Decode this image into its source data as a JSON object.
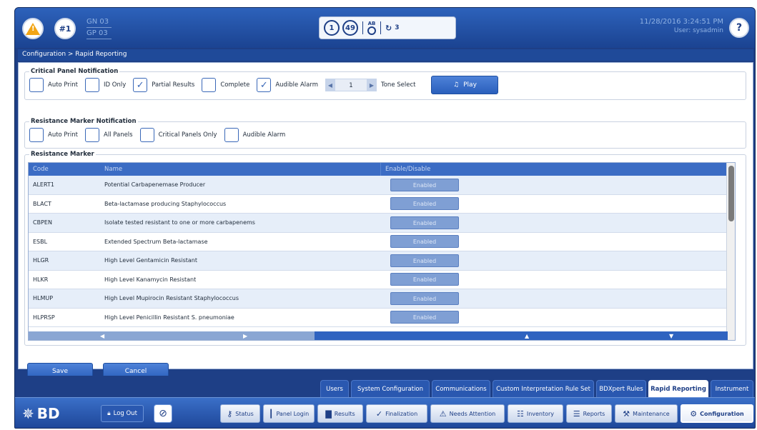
{
  "header": {
    "instrument_label": "#1",
    "counts": [
      "GN 03",
      "GP 03"
    ],
    "status_count_1": "1",
    "status_count_2": "49",
    "ab_label": "AB",
    "sync_count": "3",
    "datetime": "11/28/2016 3:24:51 PM",
    "user": "User: sysadmin",
    "help_label": "?"
  },
  "breadcrumb": "Configuration  >  Rapid Reporting",
  "critical_panel": {
    "title": "Critical Panel Notification",
    "options": [
      {
        "label": "Auto Print",
        "checked": false
      },
      {
        "label": "ID Only",
        "checked": false
      },
      {
        "label": "Partial Results",
        "checked": true
      },
      {
        "label": "Complete",
        "checked": false
      },
      {
        "label": "Audible Alarm",
        "checked": true
      }
    ],
    "tone_value": "1",
    "tone_label": "Tone Select",
    "play_label": "Play"
  },
  "resistance_notification": {
    "title": "Resistance Marker Notification",
    "options": [
      {
        "label": "Auto Print",
        "checked": false
      },
      {
        "label": "All Panels",
        "checked": false
      },
      {
        "label": "Critical Panels Only",
        "checked": false
      },
      {
        "label": "Audible Alarm",
        "checked": false
      }
    ]
  },
  "resistance_marker": {
    "title": "Resistance Marker",
    "columns": {
      "code": "Code",
      "name": "Name",
      "enable": "Enable/Disable"
    },
    "rows": [
      {
        "code": "ALERT1",
        "name": "Potential Carbapenemase Producer",
        "status": "Enabled"
      },
      {
        "code": "BLACT",
        "name": "Beta-lactamase producing Staphylococcus",
        "status": "Enabled"
      },
      {
        "code": "CBPEN",
        "name": "Isolate tested resistant to one or more carbapenems",
        "status": "Enabled"
      },
      {
        "code": "ESBL",
        "name": "Extended Spectrum Beta-lactamase",
        "status": "Enabled"
      },
      {
        "code": "HLGR",
        "name": "High Level Gentamicin Resistant",
        "status": "Enabled"
      },
      {
        "code": "HLKR",
        "name": "High Level Kanamycin Resistant",
        "status": "Enabled"
      },
      {
        "code": "HLMUP",
        "name": "High Level Mupirocin Resistant Staphylococcus",
        "status": "Enabled"
      },
      {
        "code": "HLPRSP",
        "name": "High Level Penicillin Resistant S. pneumoniae",
        "status": "Enabled"
      }
    ]
  },
  "actions": {
    "save": "Save",
    "cancel": "Cancel"
  },
  "config_tabs": [
    {
      "label": "Users",
      "active": false
    },
    {
      "label": "System Configuration",
      "active": false
    },
    {
      "label": "Communications",
      "active": false
    },
    {
      "label": "Custom Interpretation Rule Set",
      "active": false
    },
    {
      "label": "BDXpert Rules",
      "active": false
    },
    {
      "label": "Rapid Reporting",
      "active": true
    },
    {
      "label": "Instrument",
      "active": false
    }
  ],
  "nav": {
    "logo": "BD",
    "logout": "Log Out",
    "items": [
      {
        "label": "Status",
        "icon": "key-icon"
      },
      {
        "label": "Panel Login",
        "icon": "panel-icon"
      },
      {
        "label": "Results",
        "icon": "bar-chart-icon"
      },
      {
        "label": "Finalization",
        "icon": "finalization-icon"
      },
      {
        "label": "Needs Attention",
        "icon": "attention-icon"
      },
      {
        "label": "Inventory",
        "icon": "inventory-icon"
      },
      {
        "label": "Reports",
        "icon": "report-icon"
      },
      {
        "label": "Maintenance",
        "icon": "tools-icon"
      },
      {
        "label": "Configuration",
        "icon": "gear-icon"
      }
    ]
  },
  "colors": {
    "accent": "#2a5fbc",
    "frame": "#1e3f86",
    "alert": "#f2a516"
  }
}
